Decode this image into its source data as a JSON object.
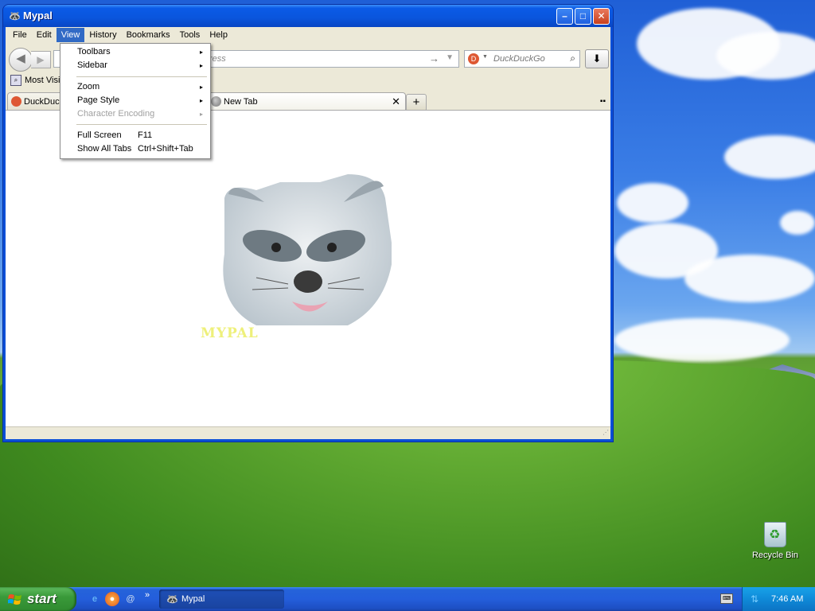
{
  "desktop": {
    "recycle_bin_label": "Recycle Bin"
  },
  "window": {
    "title": "Mypal",
    "menubar": [
      "File",
      "Edit",
      "View",
      "History",
      "Bookmarks",
      "Tools",
      "Help"
    ],
    "active_menu": "View",
    "url_placeholder": "ress",
    "search_placeholder": "DuckDuckGo",
    "bookmarks_label": "Most Visit",
    "tabs": [
      {
        "label": "DuckDuck"
      },
      {
        "label": "New Tab"
      }
    ],
    "logo_text": "MYPAL"
  },
  "view_menu": {
    "items": [
      {
        "label": "Toolbars",
        "shortcut": "",
        "submenu": "▸",
        "disabled": false
      },
      {
        "label": "Sidebar",
        "shortcut": "",
        "submenu": "▸",
        "disabled": false
      },
      {
        "label": "Zoom",
        "shortcut": "",
        "submenu": "▸",
        "disabled": false
      },
      {
        "label": "Page Style",
        "shortcut": "",
        "submenu": "▸",
        "disabled": false
      },
      {
        "label": "Character Encoding",
        "shortcut": "",
        "submenu": "▸",
        "disabled": true
      },
      {
        "label": "Full Screen",
        "shortcut": "F11",
        "submenu": "",
        "disabled": false
      },
      {
        "label": "Show All Tabs",
        "shortcut": "Ctrl+Shift+Tab",
        "submenu": "",
        "disabled": false
      }
    ]
  },
  "taskbar": {
    "start_label": "start",
    "task_button_label": "Mypal",
    "quicklaunch_more": "»",
    "clock": "7:46 AM"
  },
  "colors": {
    "menu_highlight": "#316ac5",
    "titlebar_blue": "#0a55dc",
    "start_green": "#3a9a3a",
    "ddg_orange": "#de5833"
  },
  "icons": {
    "app": "raccoon-icon",
    "back": "back-arrow-icon",
    "forward": "forward-arrow-icon",
    "go": "go-arrow-icon",
    "search": "magnifier-icon",
    "download": "download-arrow-icon",
    "new_tab": "plus-icon",
    "close_tab": "close-icon"
  }
}
